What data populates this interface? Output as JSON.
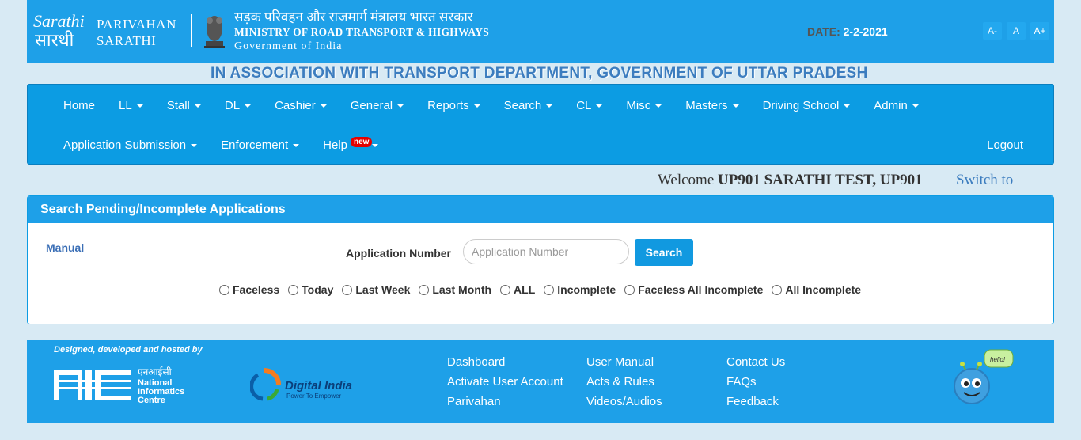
{
  "header": {
    "brand_line1": "PARIVAHAN",
    "brand_line2": "SARATHI",
    "ministry_hindi": "सड़क परिवहन और राजमार्ग मंत्रालय भारत सरकार",
    "ministry_english": "MINISTRY OF ROAD TRANSPORT & HIGHWAYS",
    "government": "Government of India",
    "date_label": "DATE:",
    "date_value": "2-2-2021",
    "font_buttons": [
      "A-",
      "A",
      "A+"
    ]
  },
  "association": "IN ASSOCIATION WITH TRANSPORT DEPARTMENT, GOVERNMENT OF UTTAR PRADESH",
  "nav": {
    "row1": [
      {
        "label": "Home",
        "dropdown": false
      },
      {
        "label": "LL",
        "dropdown": true
      },
      {
        "label": "Stall",
        "dropdown": true
      },
      {
        "label": "DL",
        "dropdown": true
      },
      {
        "label": "Cashier",
        "dropdown": true
      },
      {
        "label": "General",
        "dropdown": true
      },
      {
        "label": "Reports",
        "dropdown": true
      },
      {
        "label": "Search",
        "dropdown": true
      },
      {
        "label": "CL",
        "dropdown": true
      },
      {
        "label": "Misc",
        "dropdown": true
      },
      {
        "label": "Masters",
        "dropdown": true
      },
      {
        "label": "Driving School",
        "dropdown": true
      },
      {
        "label": "Admin",
        "dropdown": true
      }
    ],
    "row2": [
      {
        "label": "Application Submission",
        "dropdown": true
      },
      {
        "label": "Enforcement",
        "dropdown": true
      },
      {
        "label": "Help",
        "dropdown": true,
        "badge": "new"
      }
    ],
    "logout": "Logout"
  },
  "welcome": {
    "prefix": "Welcome",
    "user": "UP901 SARATHI TEST, UP901",
    "switch": "Switch to"
  },
  "panel": {
    "title": "Search Pending/Incomplete Applications",
    "manual": "Manual",
    "app_number_label": "Application Number",
    "app_number_placeholder": "Application Number",
    "app_number_value": "",
    "search_button": "Search",
    "radio_options": [
      "Faceless",
      "Today",
      "Last Week",
      "Last Month",
      "ALL",
      "Incomplete",
      "Faceless All Incomplete",
      "All Incomplete"
    ]
  },
  "footer": {
    "designed_by": "Designed, developed and hosted by",
    "nic_hindi": "एनआईसी",
    "nic_line1": "National",
    "nic_line2": "Informatics",
    "nic_line3": "Centre",
    "digital_india": "Digital India",
    "digital_india_tag": "Power To Empower",
    "col1": [
      "Dashboard",
      "Activate User Account",
      "Parivahan"
    ],
    "col2": [
      "User Manual",
      "Acts & Rules",
      "Videos/Audios"
    ],
    "col3": [
      "Contact Us",
      "FAQs",
      "Feedback"
    ],
    "mascot_bubble": "hello!"
  },
  "colors": {
    "header_blue": "#1ea0e8",
    "nav_blue": "#0c9ce3",
    "page_bg": "#d8eaf4",
    "badge_red": "#e60000"
  }
}
